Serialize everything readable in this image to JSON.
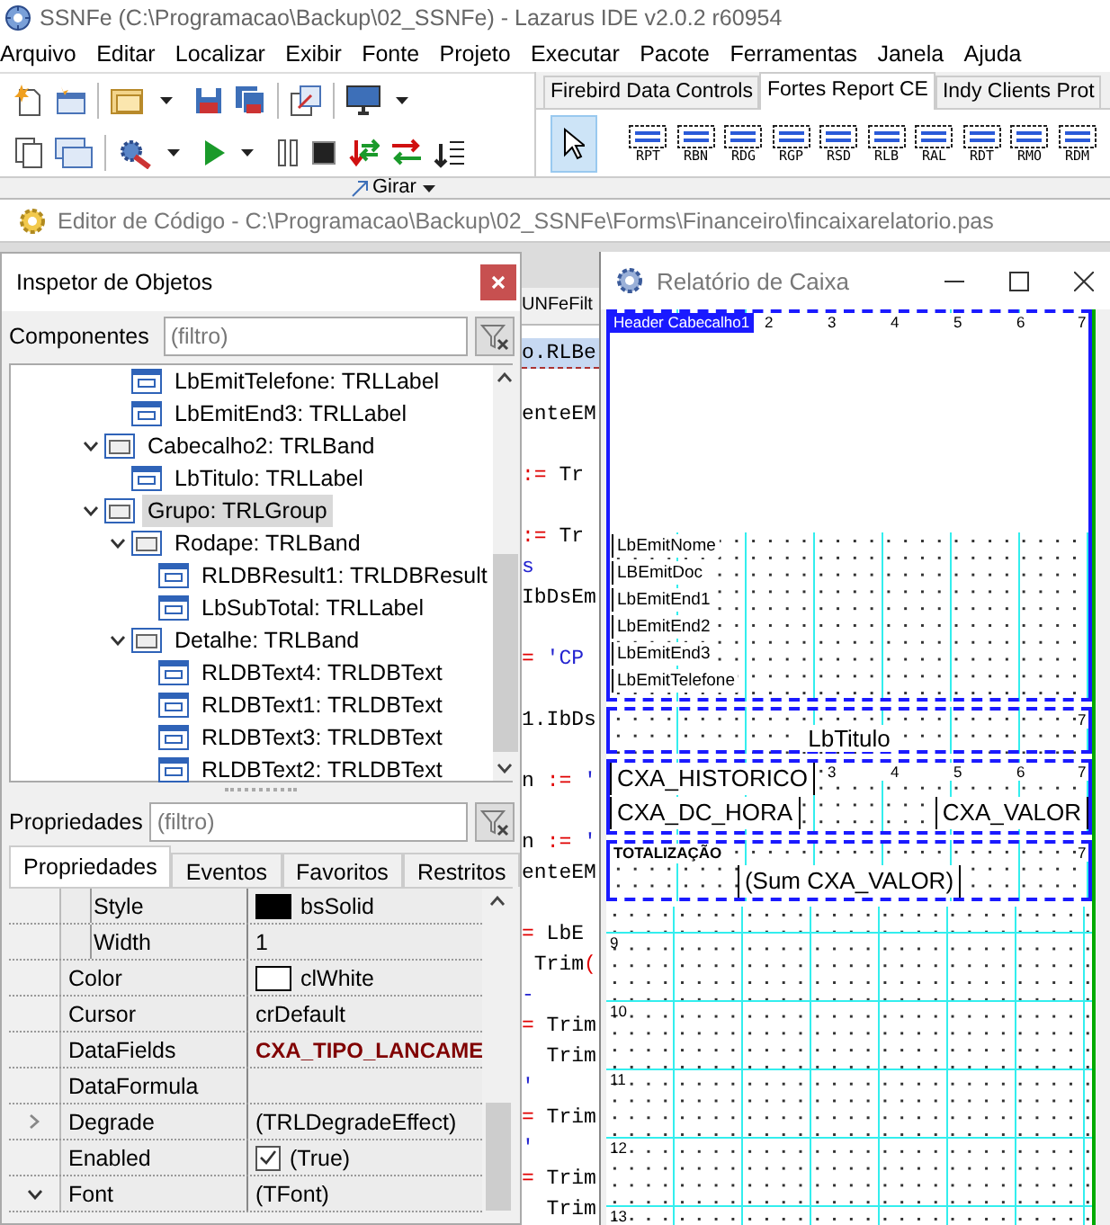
{
  "window": {
    "title": "SSNFe (C:\\Programacao\\Backup\\02_SSNFe) - Lazarus IDE v2.0.2 r60954"
  },
  "menu": [
    "Arquivo",
    "Editar",
    "Localizar",
    "Exibir",
    "Fonte",
    "Projeto",
    "Executar",
    "Pacote",
    "Ferramentas",
    "Janela",
    "Ajuda"
  ],
  "palette": {
    "tabs": [
      {
        "label": "Firebird Data Controls",
        "selected": false
      },
      {
        "label": "Fortes Report CE",
        "selected": true
      },
      {
        "label": "Indy Clients Prot",
        "selected": false
      }
    ],
    "items": [
      {
        "kind": "pointer",
        "selected": true
      },
      {
        "kind": "component",
        "label": "RPT",
        "selected": false
      },
      {
        "kind": "component",
        "label": "RBN",
        "selected": false
      },
      {
        "kind": "component",
        "label": "RDG",
        "selected": false
      },
      {
        "kind": "component",
        "label": "RGP",
        "selected": false
      },
      {
        "kind": "component",
        "label": "RSD",
        "selected": false
      },
      {
        "kind": "component",
        "label": "RLB",
        "selected": false
      },
      {
        "kind": "component",
        "label": "RAL",
        "selected": false
      },
      {
        "kind": "component",
        "label": "RDT",
        "selected": false
      },
      {
        "kind": "component",
        "label": "RMO",
        "selected": false
      },
      {
        "kind": "component",
        "label": "RDM",
        "selected": false
      }
    ]
  },
  "hidden_toolbar": {
    "button": "Girar"
  },
  "code_editor": {
    "title": "Editor de Código - C:\\Programacao\\Backup\\02_SSNFe\\Forms\\Financeiro\\fincaixarelatorio.pas",
    "tab": "UNFeFilt",
    "lines": [
      {
        "kind": "code",
        "highlighted": true,
        "segments": [
          {
            "kind": "ident",
            "text": "o.RLBe"
          }
        ]
      },
      {
        "kind": "blank"
      },
      {
        "kind": "code",
        "highlighted": false,
        "segments": [
          {
            "kind": "ident",
            "text": "enteEM"
          }
        ]
      },
      {
        "kind": "blank"
      },
      {
        "kind": "code",
        "highlighted": false,
        "segments": [
          {
            "kind": "op",
            "text": ":="
          },
          {
            "kind": "ident",
            "text": " Tr"
          }
        ]
      },
      {
        "kind": "blank"
      },
      {
        "kind": "code",
        "highlighted": false,
        "segments": [
          {
            "kind": "op",
            "text": ":="
          },
          {
            "kind": "ident",
            "text": " Tr"
          }
        ]
      },
      {
        "kind": "code",
        "highlighted": false,
        "segments": [
          {
            "kind": "string",
            "text": "s"
          }
        ]
      },
      {
        "kind": "code",
        "highlighted": false,
        "segments": [
          {
            "kind": "ident",
            "text": "IbDsEm"
          }
        ]
      },
      {
        "kind": "blank"
      },
      {
        "kind": "code",
        "highlighted": false,
        "segments": [
          {
            "kind": "op",
            "text": "="
          },
          {
            "kind": "string",
            "text": " 'CP"
          }
        ]
      },
      {
        "kind": "blank"
      },
      {
        "kind": "code",
        "highlighted": false,
        "segments": [
          {
            "kind": "ident",
            "text": "1.IbDs"
          }
        ]
      },
      {
        "kind": "blank"
      },
      {
        "kind": "code",
        "highlighted": false,
        "segments": [
          {
            "kind": "ident",
            "text": "n "
          },
          {
            "kind": "op",
            "text": ":="
          },
          {
            "kind": "string",
            "text": " '"
          }
        ]
      },
      {
        "kind": "blank"
      },
      {
        "kind": "code",
        "highlighted": false,
        "segments": [
          {
            "kind": "ident",
            "text": "n "
          },
          {
            "kind": "op",
            "text": ":="
          },
          {
            "kind": "string",
            "text": " '"
          }
        ]
      },
      {
        "kind": "code",
        "highlighted": false,
        "segments": [
          {
            "kind": "ident",
            "text": "enteEM"
          }
        ]
      },
      {
        "kind": "blank"
      },
      {
        "kind": "code",
        "highlighted": false,
        "segments": [
          {
            "kind": "op",
            "text": "="
          },
          {
            "kind": "ident",
            "text": " LbE"
          }
        ]
      },
      {
        "kind": "code",
        "highlighted": false,
        "segments": [
          {
            "kind": "ident",
            "text": " Trim"
          },
          {
            "kind": "op",
            "text": "("
          }
        ]
      },
      {
        "kind": "code",
        "highlighted": false,
        "segments": [
          {
            "kind": "string",
            "text": "-"
          }
        ]
      },
      {
        "kind": "code",
        "highlighted": false,
        "segments": [
          {
            "kind": "op",
            "text": "="
          },
          {
            "kind": "ident",
            "text": " Trim"
          }
        ]
      },
      {
        "kind": "code",
        "highlighted": false,
        "segments": [
          {
            "kind": "ident",
            "text": "  Trim"
          }
        ]
      },
      {
        "kind": "code",
        "highlighted": false,
        "segments": [
          {
            "kind": "string",
            "text": "'"
          }
        ]
      },
      {
        "kind": "code",
        "highlighted": false,
        "segments": [
          {
            "kind": "op",
            "text": "="
          },
          {
            "kind": "ident",
            "text": " Trim"
          }
        ]
      },
      {
        "kind": "code",
        "highlighted": false,
        "segments": [
          {
            "kind": "string",
            "text": "'"
          }
        ]
      },
      {
        "kind": "code",
        "highlighted": false,
        "segments": [
          {
            "kind": "op",
            "text": "="
          },
          {
            "kind": "ident",
            "text": " Trim"
          }
        ]
      },
      {
        "kind": "code",
        "highlighted": false,
        "segments": [
          {
            "kind": "ident",
            "text": "  Trim"
          }
        ]
      }
    ]
  },
  "object_inspector": {
    "title": "Inspetor de Objetos",
    "components_label": "Componentes",
    "components_filter": {
      "placeholder": "(filtro)"
    },
    "tree": {
      "cut_children": [
        {
          "label": "LbEmitTelefone: TRLLabel",
          "selected": false
        },
        {
          "label": "LbEmitEnd3: TRLLabel",
          "selected": false
        }
      ],
      "items": [
        {
          "label": "Cabecalho2: TRLBand",
          "selected": false,
          "expanded": true,
          "children": [
            {
              "label": "LbTitulo: TRLLabel",
              "selected": false
            }
          ]
        },
        {
          "label": "Grupo: TRLGroup",
          "selected": true,
          "expanded": true,
          "children": [
            {
              "label": "Rodape: TRLBand",
              "selected": false,
              "expanded": true,
              "children": [
                {
                  "label": "RLDBResult1: TRLDBResult",
                  "selected": false
                },
                {
                  "label": "LbSubTotal: TRLLabel",
                  "selected": false
                }
              ]
            },
            {
              "label": "Detalhe: TRLBand",
              "selected": false,
              "expanded": true,
              "children": [
                {
                  "label": "RLDBText4: TRLDBText",
                  "selected": false
                },
                {
                  "label": "RLDBText1: TRLDBText",
                  "selected": false
                },
                {
                  "label": "RLDBText3: TRLDBText",
                  "selected": false
                },
                {
                  "label": "RLDBText2: TRLDBText",
                  "selected": false
                }
              ]
            }
          ]
        }
      ]
    },
    "properties_label": "Propriedades",
    "properties_filter": {
      "placeholder": "(filtro)"
    },
    "tabs": [
      {
        "label": "Propriedades",
        "selected": true
      },
      {
        "label": "Eventos",
        "selected": false
      },
      {
        "label": "Favoritos",
        "selected": false
      },
      {
        "label": "Restritos",
        "selected": false
      }
    ],
    "properties": [
      {
        "kind": "sub",
        "name": "Style",
        "color": "#000000",
        "value": "bsSolid",
        "highlighted": false
      },
      {
        "kind": "sub",
        "name": "Width",
        "value": "1",
        "highlighted": false
      },
      {
        "kind": "prop",
        "name": "Color",
        "color": "#ffffff",
        "value": "clWhite",
        "highlighted": false
      },
      {
        "kind": "prop",
        "name": "Cursor",
        "value": "crDefault",
        "highlighted": false
      },
      {
        "kind": "prop",
        "name": "DataFields",
        "value": "CXA_TIPO_LANCAME",
        "highlighted": true
      },
      {
        "kind": "prop",
        "name": "DataFormula"
      },
      {
        "kind": "prop",
        "name": "Degrade",
        "value": "(TRLDegradeEffect)",
        "expanded": false,
        "highlighted": false
      },
      {
        "kind": "prop",
        "name": "Enabled",
        "checked": true,
        "value": "(True)",
        "highlighted": false
      },
      {
        "kind": "prop",
        "name": "Font",
        "value": "(TFont)",
        "expanded": true,
        "highlighted": false
      }
    ]
  },
  "report_window": {
    "title": "Relatório de Caixa",
    "bands": [
      {
        "kind": "header",
        "label": "Header Cabecalho1",
        "ruler": [
          "2",
          "3",
          "4",
          "5",
          "6",
          "7"
        ],
        "fields": [
          "LbEmitNome",
          "LBEmitDoc",
          "LbEmitEnd1",
          "LbEmitEnd2",
          "LbEmitEnd3",
          "LbEmitTelefone"
        ]
      },
      {
        "kind": "title",
        "ruler": [
          "7"
        ],
        "fields": [
          "LbTitulo"
        ]
      },
      {
        "kind": "detail",
        "ruler": [
          "3",
          "4",
          "5",
          "6",
          "7"
        ],
        "fields": [
          "CXA_HISTORICO",
          "CXA_DC_HORA",
          "CXA_VALOR"
        ]
      },
      {
        "kind": "summary",
        "ruler": [
          "7"
        ],
        "fields": [
          "TOTALIZAÇÃO",
          "(Sum CXA_VALOR)"
        ]
      }
    ],
    "grid_rows": [
      "9",
      "10",
      "11",
      "12",
      "13"
    ]
  }
}
